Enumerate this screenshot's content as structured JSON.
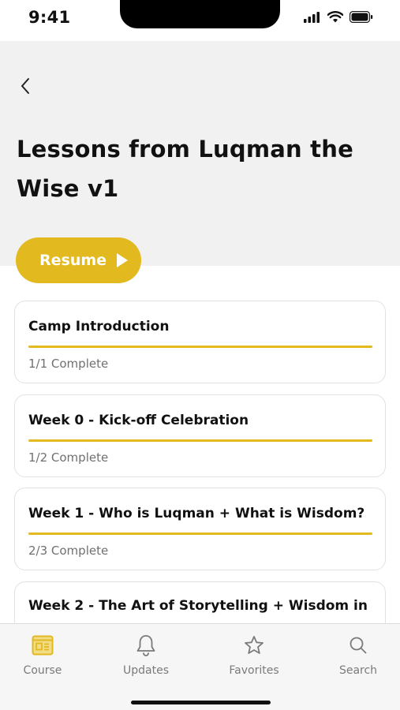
{
  "status_bar": {
    "time": "9:41"
  },
  "header": {
    "back_icon": "chevron-left-icon",
    "title": "Lessons from Luqman the Wise v1"
  },
  "resume": {
    "label": "Resume",
    "icon": "play-icon",
    "color": "#e2b91f"
  },
  "lessons": [
    {
      "title": "Camp Introduction",
      "status": "1/1 Complete",
      "completed": 1,
      "total": 1
    },
    {
      "title": "Week 0 - Kick-off Celebration",
      "status": "1/2 Complete",
      "completed": 1,
      "total": 2
    },
    {
      "title": "Week 1 - Who is Luqman + What is Wisdom?",
      "status": "2/3 Complete",
      "completed": 2,
      "total": 3
    },
    {
      "title": "Week 2 - The Art of Storytelling + Wisdom in",
      "status": "",
      "completed": null,
      "total": null
    }
  ],
  "tabs": [
    {
      "label": "Course",
      "icon": "course-icon",
      "active": true
    },
    {
      "label": "Updates",
      "icon": "bell-icon",
      "active": false
    },
    {
      "label": "Favorites",
      "icon": "star-icon",
      "active": false
    },
    {
      "label": "Search",
      "icon": "search-icon",
      "active": false
    }
  ],
  "colors": {
    "accent": "#e2b91f",
    "header_bg": "#f1f1f1",
    "tab_bar_bg": "#f6f6f6"
  }
}
